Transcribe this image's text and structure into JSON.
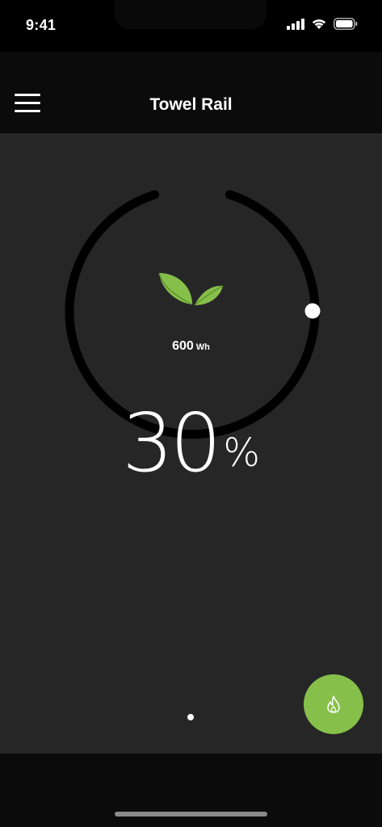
{
  "status_bar": {
    "time": "9:41",
    "icons": [
      "cellular-signal-icon",
      "wifi-icon",
      "battery-icon"
    ]
  },
  "header": {
    "title": "Towel Rail",
    "menu_icon": "hamburger-menu-icon"
  },
  "dial": {
    "energy_value": "600",
    "energy_unit": "Wh",
    "energy_icon": "leaf-icon",
    "percent_value": "30",
    "percent_unit": "%",
    "level_percent": 30
  },
  "pagination": {
    "pages": 1,
    "active": 0
  },
  "boost_button": {
    "icon": "flame-icon",
    "color": "#86c04a"
  },
  "colors": {
    "background": "#262626",
    "header": "#0b0b0b",
    "accent": "#86c04a",
    "ring": "#000000"
  }
}
